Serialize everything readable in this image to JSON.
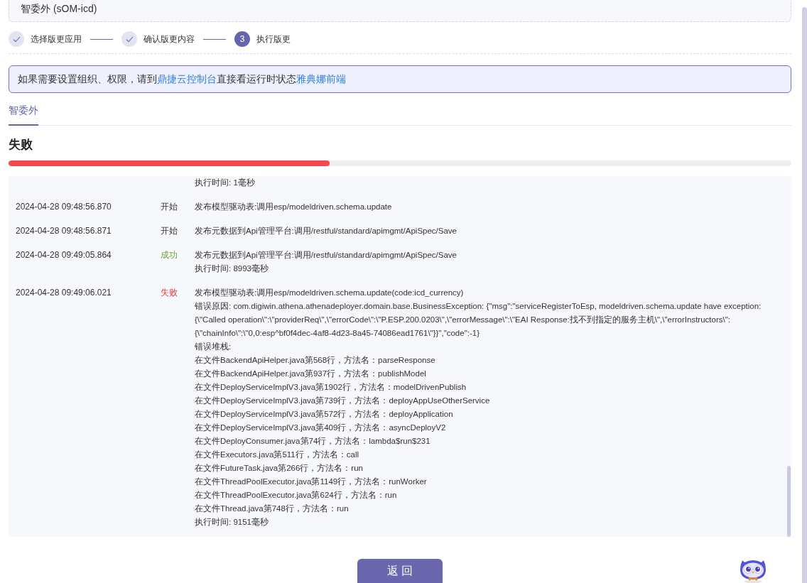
{
  "app": {
    "name": "智委外 (sOM-icd)"
  },
  "steps": [
    {
      "label": "选择版更应用",
      "done": true
    },
    {
      "label": "确认版更内容",
      "done": true
    },
    {
      "label": "执行版更",
      "number": "3",
      "done": false
    }
  ],
  "alert": {
    "parts": [
      {
        "text": "如果需要设置组织、权限，请到",
        "kind": "text"
      },
      {
        "text": "鼎捷云控制台",
        "kind": "link"
      },
      {
        "text": "直接看运行时状态",
        "kind": "text"
      },
      {
        "text": "雅典娜前端",
        "kind": "link"
      }
    ]
  },
  "tabs": [
    {
      "label": "智委外",
      "selected": true
    }
  ],
  "result": {
    "title": "失败",
    "kind": "fail",
    "level": 0.41
  },
  "log": [
    {
      "lines": [
        "执行时间: 1毫秒"
      ]
    },
    {
      "time": "2024-04-28 09:48:56.870",
      "status": "开始",
      "kind": "start",
      "lines": [
        "发布模型驱动表:调用esp/modeldriven.schema.update"
      ]
    },
    {
      "time": "2024-04-28 09:48:56.871",
      "status": "开始",
      "kind": "start",
      "lines": [
        "发布元数据到Api管理平台:调用/restful/standard/apimgmt/ApiSpec/Save"
      ]
    },
    {
      "time": "2024-04-28 09:49:05.864",
      "status": "成功",
      "kind": "success",
      "lines": [
        "发布元数据到Api管理平台:调用/restful/standard/apimgmt/ApiSpec/Save",
        "执行时间: 8993毫秒"
      ]
    },
    {
      "time": "2024-04-28 09:49:06.021",
      "status": "失败",
      "kind": "fail",
      "lines": [
        "发布模型驱动表:调用esp/modeldriven.schema.update(code:icd_currency)",
        "错误原因: com.digiwin.athena.athenadeployer.domain.base.BusinessException: {\"msg\":\"serviceRegisterToEsp, modeldriven.schema.update have exception:",
        "{\\\"Called operation\\\":\\\"providerReq\\\",\\\"errorCode\\\":\\\"P.ESP.200.0203\\\",\\\"errorMessage\\\":\\\"EAI Response:找不到指定的服务主机\\\",\\\"errorInstructors\\\":",
        "{\\\"chainInfo\\\":\\\"0,0:esp^bf0f4dec-4af8-4d23-8a45-74086ead1761\\\"}}\",\"code\":-1}",
        "错误堆栈:",
        "在文件BackendApiHelper.java第568行，方法名：parseResponse",
        "在文件BackendApiHelper.java第937行，方法名：publishModel",
        "在文件DeployServiceImplV3.java第1902行，方法名：modelDrivenPublish",
        "在文件DeployServiceImplV3.java第739行，方法名：deployAppUseOtherService",
        "在文件DeployServiceImplV3.java第572行，方法名：deployApplication",
        "在文件DeployServiceImplV3.java第409行，方法名：asyncDeployV2",
        "在文件DeployConsumer.java第74行，方法名：lambda$run$231",
        "在文件Executors.java第511行，方法名：call",
        "在文件FutureTask.java第266行，方法名：run",
        "在文件ThreadPoolExecutor.java第1149行，方法名：runWorker",
        "在文件ThreadPoolExecutor.java第624行，方法名：run",
        "在文件Thread.java第748行，方法名：run",
        "执行时间: 9151毫秒"
      ]
    }
  ],
  "back_button": "返 回"
}
